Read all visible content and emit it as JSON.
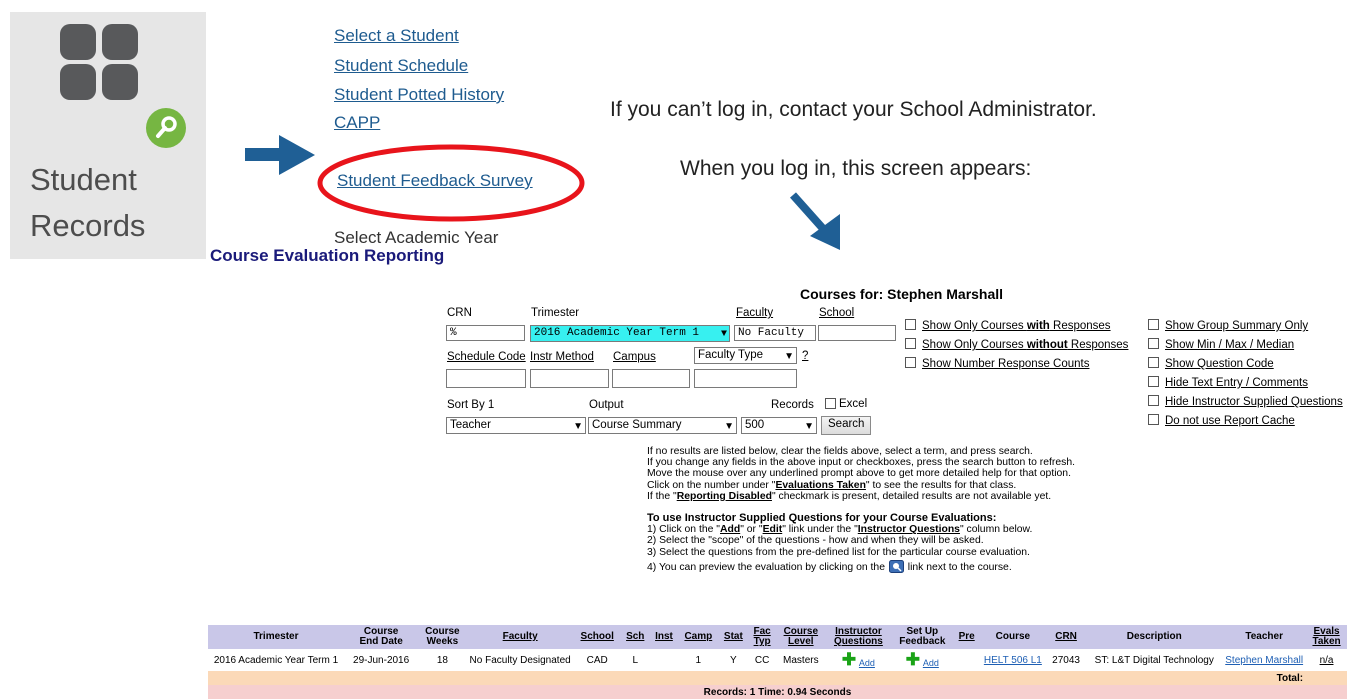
{
  "tile": {
    "label_line1": "Student",
    "label_line2": "Records"
  },
  "menu": {
    "items": [
      "Select a Student",
      "Student Schedule",
      "Student Potted History",
      "CAPP",
      "Student Feedback Survey",
      "Select Academic Year"
    ]
  },
  "notes": {
    "login_help": "If you can’t log in, contact your School Administrator.",
    "screen_appears": "When you log in, this screen appears:"
  },
  "page": {
    "title": "Course Evaluation Reporting",
    "courses_for": "Courses for: Stephen Marshall"
  },
  "form": {
    "crn_label": "CRN",
    "crn_value": "%",
    "trimester_label": "Trimester",
    "trimester_value": "2016 Academic Year Term 1",
    "faculty_label": "Faculty",
    "faculty_value": "No Faculty",
    "school_label": "School",
    "schedule_code_label": "Schedule Code",
    "instr_method_label": "Instr Method",
    "campus_label": "Campus",
    "faculty_type_value": "Faculty Type",
    "help_link": "?",
    "sort_by_label": "Sort By 1",
    "sort_by_value": "Teacher",
    "output_label": "Output",
    "output_value": "Course Summary",
    "records_label": "Records",
    "records_value": "500",
    "excel_label": "Excel",
    "search_button": "Search"
  },
  "options_mid": [
    {
      "pre": "Show Only Courses ",
      "bold": "with",
      "post": " Responses"
    },
    {
      "pre": "Show Only Courses ",
      "bold": "without",
      "post": " Responses"
    },
    {
      "pre": "Show Number Response Counts",
      "bold": "",
      "post": ""
    }
  ],
  "options_right": [
    "Show Group Summary Only",
    "Show Min / Max / Median",
    "Show Question Code",
    "Hide Text Entry / Comments",
    "Hide Instructor Supplied Questions",
    "Do not use Report Cache"
  ],
  "info": {
    "l1": "If no results are listed below, clear the fields above, select a term, and press search.",
    "l2": "If you change any fields in the above input or checkboxes, press the search button to refresh.",
    "l3": "Move the mouse over any underlined prompt above to get more detailed help for that option.",
    "l4_pre": "Click on the number under \"",
    "l4_bold": "Evaluations Taken",
    "l4_post": "\" to see the results for that class.",
    "l5_pre": "If the \"",
    "l5_bold": "Reporting Disabled",
    "l5_post": "\" checkmark is present, detailed results are not available yet.",
    "h2": "To use Instructor Supplied Questions for your Course Evaluations:",
    "s1_a": "1) Click on the \"",
    "s1_b": "Add",
    "s1_c": "\" or \"",
    "s1_d": "Edit",
    "s1_e": "\" link under the \"",
    "s1_f": "Instructor Questions",
    "s1_g": "\" column below.",
    "s2": "2) Select the \"scope\" of the questions - how and when they will be asked.",
    "s3": "3) Select the questions from the pre-defined list for the particular course evaluation.",
    "s4_a": "4) You can preview the evaluation by clicking on the",
    "s4_b": "link next to the course."
  },
  "table": {
    "headers": {
      "trimester": "Trimester",
      "end_date_1": "Course",
      "end_date_2": "End Date",
      "weeks_1": "Course",
      "weeks_2": "Weeks",
      "faculty": "Faculty",
      "school": "School",
      "sch": "Sch",
      "inst": "Inst",
      "camp": "Camp",
      "stat": "Stat",
      "fac_typ_1": "Fac",
      "fac_typ_2": "Typ",
      "level_1": "Course",
      "level_2": "Level",
      "iq_1": "Instructor",
      "iq_2": "Questions",
      "fb_1": "Set Up",
      "fb_2": "Feedback",
      "pre": "Pre",
      "course": "Course",
      "crn": "CRN",
      "description": "Description",
      "teacher": "Teacher",
      "evals_1": "Evals",
      "evals_2": "Taken"
    },
    "row": {
      "trimester": "2016 Academic Year Term 1",
      "end_date": "29-Jun-2016",
      "weeks": "18",
      "faculty": "No Faculty Designated",
      "school": "CAD",
      "sch": "L",
      "inst": "",
      "camp": "1",
      "stat": "Y",
      "fac_typ": "CC",
      "level": "Masters",
      "iq_add": "Add",
      "fb_add": "Add",
      "pre": "",
      "course": "HELT 506 L1",
      "crn": "27043",
      "description": "ST: L&T Digital Technology",
      "teacher": "Stephen Marshall",
      "evals": "n/a"
    },
    "total_label": "Total:",
    "footer": "Records: 1 Time: 0.94 Seconds"
  },
  "colors": {
    "tile_bg": "#e6e6e6",
    "key_green": "#76b642",
    "arrow_blue": "#1f5f95",
    "circle_red": "#e8141b",
    "header_bg": "#c9c7e8",
    "total_bg": "#fbd9b8"
  }
}
